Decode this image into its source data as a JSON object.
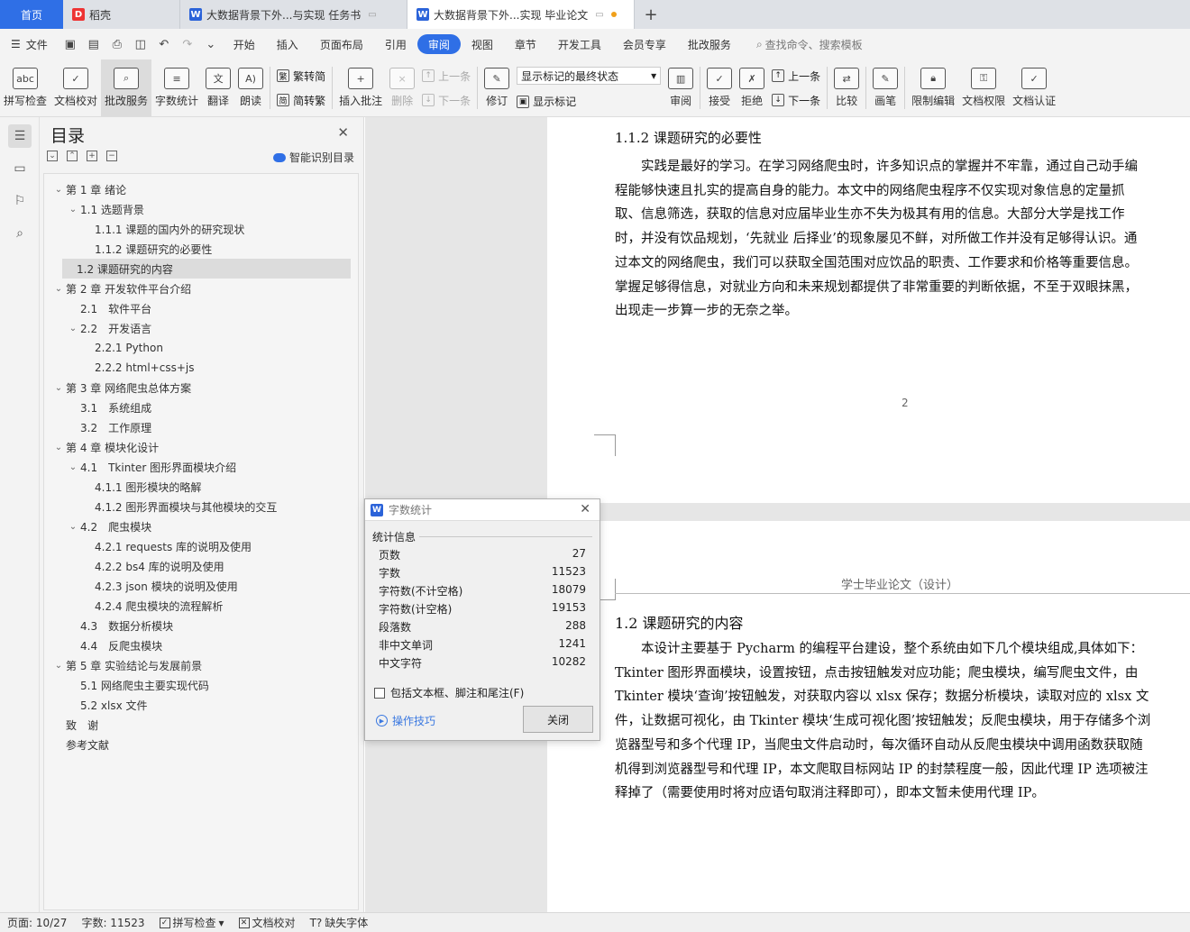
{
  "tabs": {
    "home": "首页",
    "items": [
      {
        "label": "稻壳",
        "icon": "daoke-icon"
      },
      {
        "label": "大数据背景下外...与实现 任务书",
        "icon": "wps-writer-icon"
      },
      {
        "label": "大数据背景下外...实现 毕业论文",
        "icon": "wps-writer-icon"
      }
    ],
    "add": "+"
  },
  "menu": {
    "file": "文件",
    "items": [
      "开始",
      "插入",
      "页面布局",
      "引用",
      "审阅",
      "视图",
      "章节",
      "开发工具",
      "会员专享",
      "批改服务"
    ],
    "active": "审阅",
    "search": "查找命令、搜索模板"
  },
  "ribbon": {
    "spell": "拼写检查",
    "proof": "文档校对",
    "revise_service": "批改服务",
    "word_count": "字数统计",
    "translate": "翻译",
    "read": "朗读",
    "trad": "繁转简",
    "simp": "简转繁",
    "insert_comment": "插入批注",
    "delete": "删除",
    "prev1": "上一条",
    "next1": "下一条",
    "track": "修订",
    "markup_state": "显示标记的最终状态",
    "show_markup": "显示标记",
    "review": "审阅",
    "accept": "接受",
    "reject": "拒绝",
    "prev2": "上一条",
    "next2": "下一条",
    "compare": "比较",
    "pen": "画笔",
    "restrict": "限制编辑",
    "doc_perm": "文档权限",
    "doc_auth": "文档认证"
  },
  "toc": {
    "title": "目录",
    "smart": "智能识别目录",
    "items": [
      {
        "label": "第 1 章 绪论",
        "level": 0,
        "chev": "⌄"
      },
      {
        "label": "1.1 选题背景",
        "level": 1,
        "chev": "⌄"
      },
      {
        "label": "1.1.1 课题的国内外的研究现状",
        "level": 2,
        "chev": ""
      },
      {
        "label": "1.1.2 课题研究的必要性",
        "level": 2,
        "chev": ""
      },
      {
        "label": "1.2 课题研究的内容",
        "level": 1,
        "chev": "",
        "selected": true
      },
      {
        "label": "第 2 章 开发软件平台介绍",
        "level": 0,
        "chev": "⌄"
      },
      {
        "label": "2.1　软件平台",
        "level": 1,
        "chev": ""
      },
      {
        "label": "2.2　开发语言",
        "level": 1,
        "chev": "⌄"
      },
      {
        "label": "2.2.1 Python",
        "level": 2,
        "chev": ""
      },
      {
        "label": "2.2.2 html+css+js",
        "level": 2,
        "chev": ""
      },
      {
        "label": "第 3 章 网络爬虫总体方案",
        "level": 0,
        "chev": "⌄"
      },
      {
        "label": "3.1　系统组成",
        "level": 1,
        "chev": ""
      },
      {
        "label": "3.2　工作原理",
        "level": 1,
        "chev": ""
      },
      {
        "label": "第 4 章 模块化设计",
        "level": 0,
        "chev": "⌄"
      },
      {
        "label": "4.1　Tkinter 图形界面模块介绍",
        "level": 1,
        "chev": "⌄"
      },
      {
        "label": "4.1.1 图形模块的略解",
        "level": 2,
        "chev": ""
      },
      {
        "label": "4.1.2 图形界面模块与其他模块的交互",
        "level": 2,
        "chev": ""
      },
      {
        "label": "4.2　爬虫模块",
        "level": 1,
        "chev": "⌄"
      },
      {
        "label": "4.2.1 requests 库的说明及使用",
        "level": 2,
        "chev": ""
      },
      {
        "label": "4.2.2 bs4 库的说明及使用",
        "level": 2,
        "chev": ""
      },
      {
        "label": "4.2.3 json 模块的说明及使用",
        "level": 2,
        "chev": ""
      },
      {
        "label": "4.2.4 爬虫模块的流程解析",
        "level": 2,
        "chev": ""
      },
      {
        "label": "4.3　数据分析模块",
        "level": 1,
        "chev": ""
      },
      {
        "label": "4.4　反爬虫模块",
        "level": 1,
        "chev": ""
      },
      {
        "label": "第 5 章 实验结论与发展前景",
        "level": 0,
        "chev": "⌄"
      },
      {
        "label": "5.1 网络爬虫主要实现代码",
        "level": 1,
        "chev": ""
      },
      {
        "label": "5.2 xlsx 文件",
        "level": 1,
        "chev": ""
      },
      {
        "label": "致　谢",
        "level": 0,
        "chev": ""
      },
      {
        "label": "参考文献",
        "level": 0,
        "chev": ""
      }
    ]
  },
  "doc": {
    "page1_heading": "1.1.2 课题研究的必要性",
    "page1_lines": [
      "　　实践是最好的学习。在学习网络爬虫时，许多知识点的掌握并不牢靠，通过自己动手编",
      "程能够快速且扎实的提高自身的能力。本文中的网络爬虫程序不仅实现对象信息的定量抓",
      "取、信息筛选，获取的信息对应届毕业生亦不失为极其有用的信息。大部分大学是找工作",
      "时，并没有饮品规划，‘先就业 后择业’的现象屡见不鲜，对所做工作并没有足够得认识。通",
      "过本文的网络爬虫，我们可以获取全国范围对应饮品的职责、工作要求和价格等重要信息。",
      "掌握足够得信息，对就业方向和未来规划都提供了非常重要的判断依据，不至于双眼抹黑，",
      "出现走一步算一步的无奈之举。"
    ],
    "page_number": "2",
    "page2_header": "学士毕业论文（设计）",
    "page2_heading": "1.2 课题研究的内容",
    "page2_lines": [
      "　　本设计主要基于 Pycharm 的编程平台建设，整个系统由如下几个模块组成,具体如下：",
      "Tkinter 图形界面模块，设置按钮，点击按钮触发对应功能；爬虫模块，编写爬虫文件，由",
      "Tkinter 模块‘查询’按钮触发，对获取内容以 xlsx 保存；数据分析模块，读取对应的 xlsx 文",
      "件，让数据可视化，由 Tkinter 模块‘生成可视化图’按钮触发；反爬虫模块，用于存储多个浏",
      "览器型号和多个代理 IP，当爬虫文件启动时，每次循环自动从反爬虫模块中调用函数获取随",
      "机得到浏览器型号和代理 IP，本文爬取目标网站 IP 的封禁程度一般，因此代理 IP 选项被注",
      "释掉了（需要使用时将对应语句取消注释即可），即本文暂未使用代理 IP。"
    ]
  },
  "dialog": {
    "title": "字数统计",
    "section": "统计信息",
    "stats": [
      {
        "label": "页数",
        "value": "27"
      },
      {
        "label": "字数",
        "value": "11523"
      },
      {
        "label": "字符数(不计空格)",
        "value": "18079"
      },
      {
        "label": "字符数(计空格)",
        "value": "19153"
      },
      {
        "label": "段落数",
        "value": "288"
      },
      {
        "label": "非中文单词",
        "value": "1241"
      },
      {
        "label": "中文字符",
        "value": "10282"
      }
    ],
    "checkbox": "包括文本框、脚注和尾注(F)",
    "tips": "操作技巧",
    "close": "关闭"
  },
  "status": {
    "page": "页面: 10/27",
    "words": "字数: 11523",
    "spell": "拼写检查",
    "proof": "文档校对",
    "missing_font": "缺失字体"
  }
}
